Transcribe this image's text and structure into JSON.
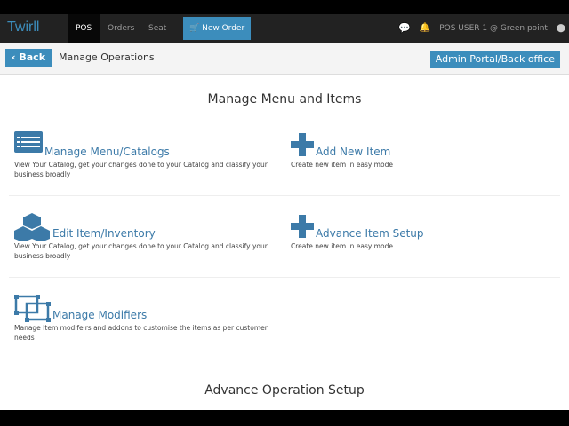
{
  "nav": {
    "logo": "Twirll",
    "items": [
      "POS",
      "Orders",
      "Seat"
    ],
    "new_order": "New Order",
    "user": "POS USER 1 @ Green point"
  },
  "sub": {
    "back": "Back",
    "title": "Manage Operations",
    "admin": "Admin Portal/Back office"
  },
  "main": {
    "section1": "Manage Menu and Items",
    "section2": "Advance Operation Setup",
    "cards": [
      {
        "title": "Manage Menu/Catalogs",
        "desc": "View Your Catalog, get your changes done to your Catalog and classify your business broadly",
        "icon": "list-icon"
      },
      {
        "title": "Add New Item",
        "desc": "Create new item in easy mode",
        "icon": "plus-icon"
      },
      {
        "title": "Edit Item/Inventory",
        "desc": "View Your Catalog, get your changes done to your Catalog and classify your business broadly",
        "icon": "cubes-icon"
      },
      {
        "title": "Advance Item Setup",
        "desc": "Create new item in easy mode",
        "icon": "plus-icon"
      },
      {
        "title": "Manage Modifiers",
        "desc": "Manage Item modifeirs and addons to customise the items as per customer needs",
        "icon": "modifiers-icon"
      }
    ]
  },
  "colors": {
    "accent": "#3c8dbc",
    "nav": "#222222"
  }
}
